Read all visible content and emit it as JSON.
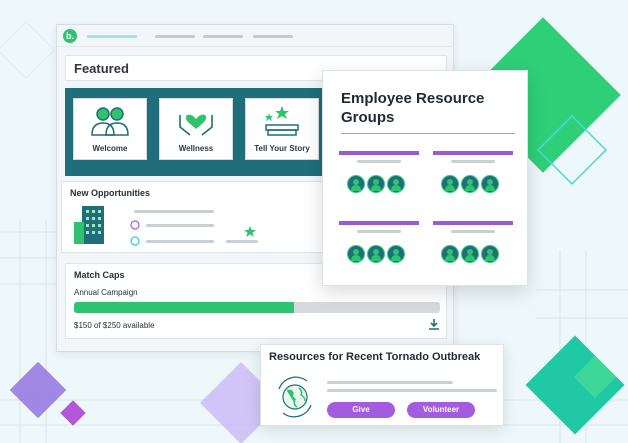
{
  "header": {
    "logo_text": "b."
  },
  "featured": {
    "title": "Featured",
    "tiles": [
      {
        "label": "Welcome",
        "icon": "people-icon"
      },
      {
        "label": "Wellness",
        "icon": "heart-hands-icon"
      },
      {
        "label": "Tell Your Story",
        "icon": "book-stars-icon"
      }
    ]
  },
  "opportunities": {
    "title": "New Opportunities",
    "icon": "building-icon"
  },
  "match_caps": {
    "title": "Match Caps",
    "campaign": "Annual Campaign",
    "progress": 0.6,
    "available": "$150 of $250 available"
  },
  "erg": {
    "title": "Employee Resource Groups"
  },
  "resources": {
    "title": "Resources for Recent Tornado Outbreak",
    "give_label": "Give",
    "volunteer_label": "Volunteer",
    "icon": "globe-refresh-icon"
  },
  "colors": {
    "teal": "#1f6e79",
    "green": "#2fc26f",
    "purple": "#a35be0"
  }
}
